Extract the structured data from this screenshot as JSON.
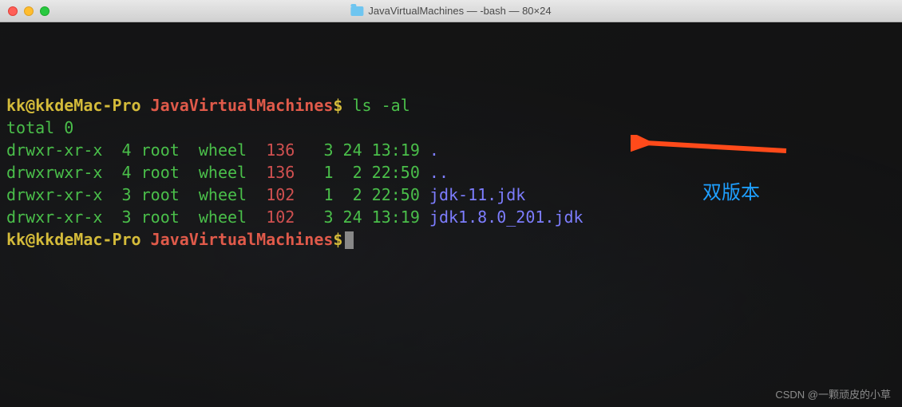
{
  "titlebar": {
    "title": "JavaVirtualMachines — -bash — 80×24"
  },
  "prompt": {
    "user_host": "kk@kkdeMac-Pro",
    "path": "JavaVirtualMachines",
    "symbol": "$"
  },
  "command": "ls -al",
  "output": {
    "total": "total 0",
    "rows": [
      {
        "perm": "drwxr-xr-x",
        "links": "4",
        "owner": "root",
        "group": "wheel",
        "size": "136",
        "month": "3",
        "day": "24",
        "time": "13:19",
        "name": "."
      },
      {
        "perm": "drwxrwxr-x",
        "links": "4",
        "owner": "root",
        "group": "wheel",
        "size": "136",
        "month": "1",
        "day": "2",
        "time": "22:50",
        "name": ".."
      },
      {
        "perm": "drwxr-xr-x",
        "links": "3",
        "owner": "root",
        "group": "wheel",
        "size": "102",
        "month": "1",
        "day": "2",
        "time": "22:50",
        "name": "jdk-11.jdk"
      },
      {
        "perm": "drwxr-xr-x",
        "links": "3",
        "owner": "root",
        "group": "wheel",
        "size": "102",
        "month": "3",
        "day": "24",
        "time": "13:19",
        "name": "jdk1.8.0_201.jdk"
      }
    ]
  },
  "annotation": {
    "label": "双版本",
    "arrow_color": "#ff4a1a"
  },
  "watermark": "CSDN @一颗顽皮的小草"
}
